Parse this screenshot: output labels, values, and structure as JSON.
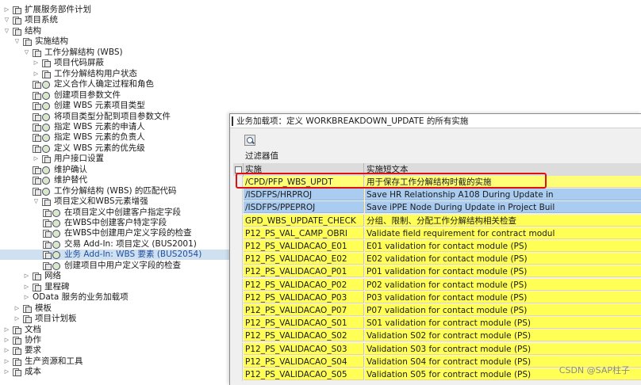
{
  "tree": {
    "items": [
      {
        "label": "扩展服务部件计划",
        "toggle": "▷",
        "indent": 0,
        "icon": "folder"
      },
      {
        "label": "项目系统",
        "toggle": "▽",
        "indent": 0,
        "icon": "folder"
      },
      {
        "label": "结构",
        "toggle": "▽",
        "indent": 1,
        "icon": "folder"
      },
      {
        "label": "实施结构",
        "toggle": "▽",
        "indent": 2,
        "icon": "folder"
      },
      {
        "label": "工作分解结构 (WBS)",
        "toggle": "▽",
        "indent": 3,
        "icon": "folder"
      },
      {
        "label": "项目代码屏蔽",
        "toggle": "▷",
        "indent": 4,
        "icon": "folder"
      },
      {
        "label": "工作分解结构用户状态",
        "toggle": "▷",
        "indent": 4,
        "icon": "folder"
      },
      {
        "label": "定义合作人确定过程和角色",
        "toggle": "",
        "indent": 4,
        "icon": "exec"
      },
      {
        "label": "创建项目参数文件",
        "toggle": "",
        "indent": 4,
        "icon": "exec"
      },
      {
        "label": "创建 WBS 元素项目类型",
        "toggle": "",
        "indent": 4,
        "icon": "exec"
      },
      {
        "label": "将项目类型分配到项目参数文件",
        "toggle": "",
        "indent": 4,
        "icon": "exec"
      },
      {
        "label": "指定 WBS 元素的申请人",
        "toggle": "",
        "indent": 4,
        "icon": "exec"
      },
      {
        "label": "指定 WBS 元素的负责人",
        "toggle": "",
        "indent": 4,
        "icon": "exec"
      },
      {
        "label": "定义 WBS 元素的优先级",
        "toggle": "",
        "indent": 4,
        "icon": "exec"
      },
      {
        "label": "用户接口设置",
        "toggle": "▷",
        "indent": 4,
        "icon": "folder"
      },
      {
        "label": "维护确认",
        "toggle": "",
        "indent": 4,
        "icon": "exec"
      },
      {
        "label": "维护替代",
        "toggle": "",
        "indent": 4,
        "icon": "exec"
      },
      {
        "label": "工作分解结构 (WBS) 的匹配代码",
        "toggle": "",
        "indent": 4,
        "icon": "exec"
      },
      {
        "label": "项目定义和WBS元素增强",
        "toggle": "▽",
        "indent": 4,
        "icon": "folder"
      },
      {
        "label": "在项目定义中创建客户指定字段",
        "toggle": "",
        "indent": 5,
        "icon": "exec"
      },
      {
        "label": "在WBS中创建客户特定字段",
        "toggle": "",
        "indent": 5,
        "icon": "exec"
      },
      {
        "label": "在WBS中创建用户定义字段的检查",
        "toggle": "",
        "indent": 5,
        "icon": "exec"
      },
      {
        "label": "交易 Add-In: 项目定义 (BUS2001)",
        "toggle": "",
        "indent": 5,
        "icon": "exec"
      },
      {
        "label": "业务 Add-In: WBS 要素 (BUS2054)",
        "toggle": "",
        "indent": 5,
        "icon": "exec",
        "selected": true
      },
      {
        "label": "创建项目中用户定义字段的检查",
        "toggle": "",
        "indent": 5,
        "icon": "exec"
      },
      {
        "label": "网络",
        "toggle": "▷",
        "indent": 3,
        "icon": "folder"
      },
      {
        "label": "里程碑",
        "toggle": "▷",
        "indent": 3,
        "icon": "folder"
      },
      {
        "label": "OData 服务的业务加载项",
        "toggle": "▷",
        "indent": 3,
        "icon": "none"
      },
      {
        "label": "模板",
        "toggle": "▷",
        "indent": 2,
        "icon": "folder"
      },
      {
        "label": "项目计划板",
        "toggle": "▷",
        "indent": 2,
        "icon": "folder"
      },
      {
        "label": "文档",
        "toggle": "▷",
        "indent": 1,
        "icon": "folder"
      },
      {
        "label": "协作",
        "toggle": "▷",
        "indent": 1,
        "icon": "folder"
      },
      {
        "label": "要求",
        "toggle": "▷",
        "indent": 1,
        "icon": "folder"
      },
      {
        "label": "生产资源和工具",
        "toggle": "▷",
        "indent": 1,
        "icon": "folder"
      },
      {
        "label": "成本",
        "toggle": "▷",
        "indent": 1,
        "icon": "folder"
      }
    ]
  },
  "popup": {
    "title": "业务加载项：定义 WORKBREAKDOWN_UPDATE 的所有实施",
    "filter_label": "过滤器值",
    "columns": [
      "实施",
      "实施短文本"
    ],
    "rows": [
      {
        "impl": "/CPD/PFP_WBS_UPDT",
        "text": "用于保存工作分解结构时截的实施",
        "style": "first"
      },
      {
        "impl": "/ISDFPS/HRPROJ",
        "text": "Save HR Relationship A108 During Update in",
        "style": "blue"
      },
      {
        "impl": "/ISDFPS/PPEPROJ",
        "text": "Save iPPE Node During Update in Project Buil",
        "style": "blue"
      },
      {
        "impl": "GPD_WBS_UPDATE_CHECK",
        "text": "分组、限制、分配工作分解结构相关检查",
        "style": "yellow"
      },
      {
        "impl": "P12_PS_VAL_CAMP_OBRI",
        "text": "Validate field requirement for contract modul",
        "style": "yellow"
      },
      {
        "impl": "P12_PS_VALIDACAO_E01",
        "text": "E01 validation for contact module (PS)",
        "style": "yellow"
      },
      {
        "impl": "P12_PS_VALIDACAO_E02",
        "text": "E02 validation for contact module (PS)",
        "style": "yellow"
      },
      {
        "impl": "P12_PS_VALIDACAO_P01",
        "text": "P01 validation for contact module (PS)",
        "style": "yellow"
      },
      {
        "impl": "P12_PS_VALIDACAO_P02",
        "text": "P02 validation for contact module (PS)",
        "style": "yellow"
      },
      {
        "impl": "P12_PS_VALIDACAO_P03",
        "text": "P03 validation for contact module (PS)",
        "style": "yellow"
      },
      {
        "impl": "P12_PS_VALIDACAO_P07",
        "text": "P07 validation for contact module (PS)",
        "style": "yellow"
      },
      {
        "impl": "P12_PS_VALIDACAO_S01",
        "text": "S01 validation for contract module (PS)",
        "style": "yellow"
      },
      {
        "impl": "P12_PS_VALIDACAO_S02",
        "text": "Validation S02 for contract module (PS)",
        "style": "yellow"
      },
      {
        "impl": "P12_PS_VALIDACAO_S03",
        "text": "Validation S03 for contract module (PS)",
        "style": "yellow"
      },
      {
        "impl": "P12_PS_VALIDACAO_S04",
        "text": "Validation S04 for contract module (PS)",
        "style": "yellow"
      },
      {
        "impl": "P12_PS_VALIDACAO_S05",
        "text": "Validation S05 for contract module (PS)",
        "style": "yellow"
      }
    ]
  },
  "watermark": "CSDN @SAP柱子",
  "colors": {
    "row_yellow": "#ffff55",
    "row_blue": "#a9ccf0",
    "highlight": "#e01010",
    "selected": "#cfe0f0"
  }
}
